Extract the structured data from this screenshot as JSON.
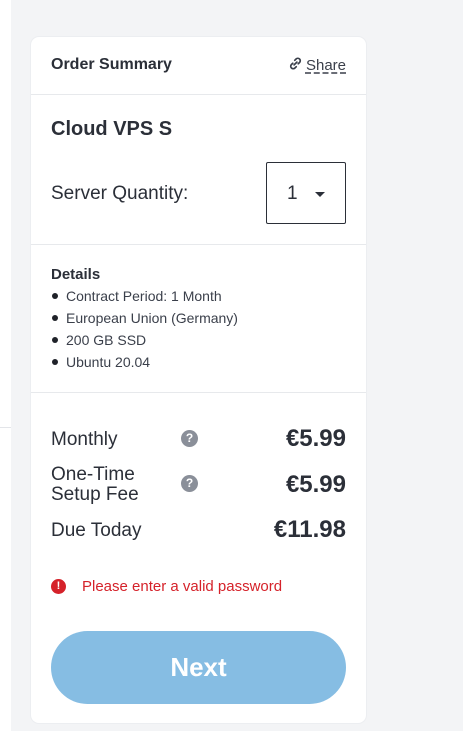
{
  "header": {
    "title": "Order Summary",
    "share_label": "Share"
  },
  "product": {
    "name": "Cloud VPS S",
    "quantity_label": "Server Quantity:",
    "quantity_value": "1"
  },
  "details": {
    "title": "Details",
    "items": [
      "Contract Period: 1 Month",
      "European Union (Germany)",
      "200 GB SSD",
      "Ubuntu 20.04"
    ]
  },
  "pricing": {
    "monthly_label": "Monthly",
    "monthly_value": "€5.99",
    "setup_label_line1": "One-Time",
    "setup_label_line2": "Setup Fee",
    "setup_value": "€5.99",
    "due_label": "Due Today",
    "due_value": "€11.98",
    "help_glyph": "?"
  },
  "error": {
    "icon_glyph": "!",
    "message": "Please enter a valid password"
  },
  "actions": {
    "next_label": "Next"
  },
  "colors": {
    "accent_button": "#86bde3",
    "error": "#d5222a",
    "text": "#2b2f38",
    "page_background": "#f3f4f6"
  },
  "icons": {
    "share": "link-icon",
    "help": "question-circle-icon",
    "error": "exclamation-circle-icon",
    "dropdown": "caret-down-icon"
  }
}
